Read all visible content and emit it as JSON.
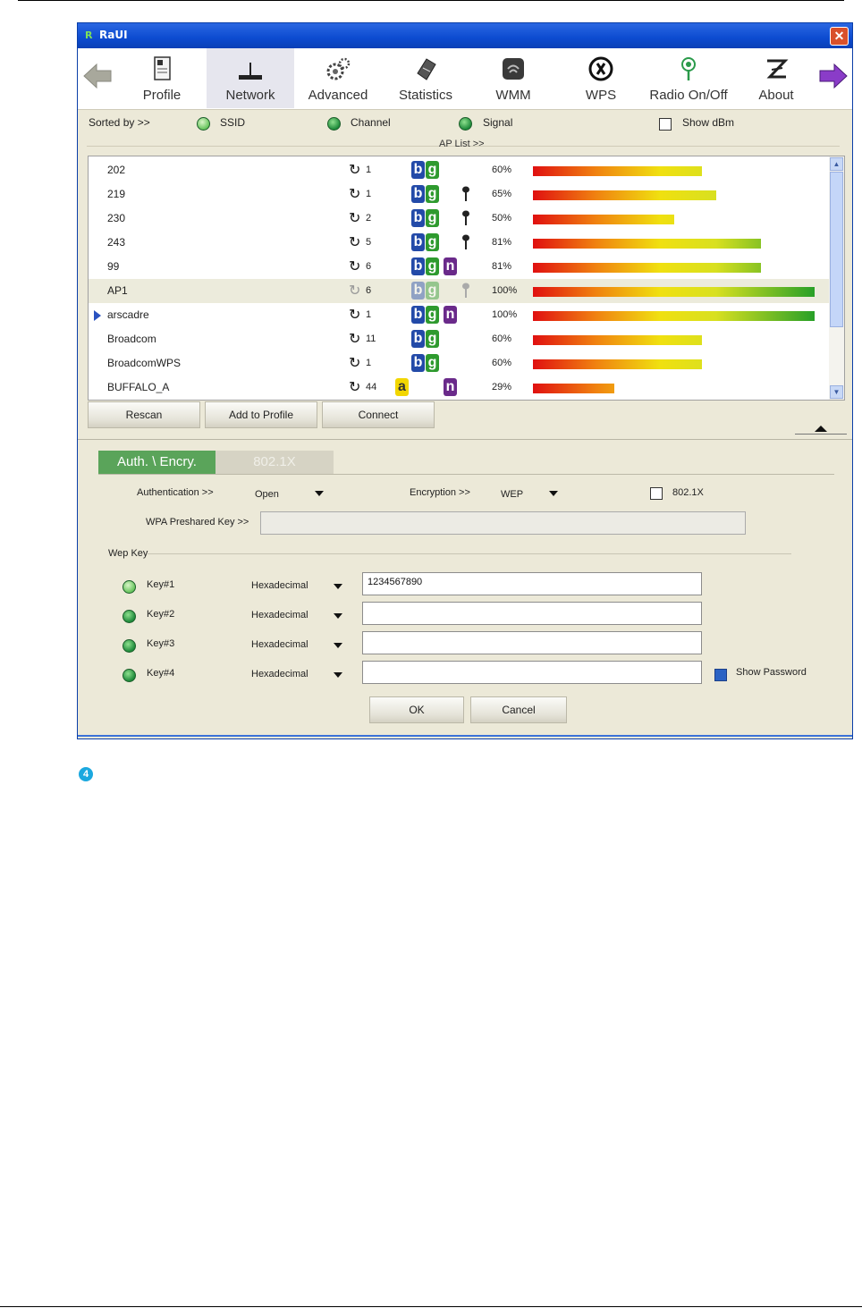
{
  "window": {
    "title": "RaUI",
    "close_glyph": "✕",
    "app_icon": "R"
  },
  "toolbar": {
    "back_icon": "arrow-left-icon",
    "forward_icon": "arrow-right-icon",
    "items": [
      {
        "label": "Profile",
        "icon": "profile-icon",
        "active": false
      },
      {
        "label": "Network",
        "icon": "network-icon",
        "active": true
      },
      {
        "label": "Advanced",
        "icon": "advanced-gear-icon",
        "active": false
      },
      {
        "label": "Statistics",
        "icon": "statistics-icon",
        "active": false
      },
      {
        "label": "WMM",
        "icon": "wmm-icon",
        "active": false
      },
      {
        "label": "WPS",
        "icon": "wps-icon",
        "active": false
      },
      {
        "label": "Radio On/Off",
        "icon": "radio-icon",
        "active": false
      },
      {
        "label": "About",
        "icon": "about-icon",
        "active": false
      }
    ]
  },
  "sort": {
    "label": "Sorted by >>",
    "ssid": "SSID",
    "channel": "Channel",
    "signal": "Signal",
    "show_dbm": "Show dBm"
  },
  "ap_list": {
    "title": "AP List >>",
    "rows": [
      {
        "ssid": "202",
        "channel": "1",
        "a": false,
        "b": true,
        "g": true,
        "n": false,
        "locked": false,
        "signal": "60%",
        "signal_value": 60,
        "selected": false,
        "connected": false
      },
      {
        "ssid": "219",
        "channel": "1",
        "a": false,
        "b": true,
        "g": true,
        "n": false,
        "locked": true,
        "signal": "65%",
        "signal_value": 65,
        "selected": false,
        "connected": false
      },
      {
        "ssid": "230",
        "channel": "2",
        "a": false,
        "b": true,
        "g": true,
        "n": false,
        "locked": true,
        "signal": "50%",
        "signal_value": 50,
        "selected": false,
        "connected": false
      },
      {
        "ssid": "243",
        "channel": "5",
        "a": false,
        "b": true,
        "g": true,
        "n": false,
        "locked": true,
        "signal": "81%",
        "signal_value": 81,
        "selected": false,
        "connected": false
      },
      {
        "ssid": "99",
        "channel": "6",
        "a": false,
        "b": true,
        "g": true,
        "n": true,
        "locked": false,
        "signal": "81%",
        "signal_value": 81,
        "selected": false,
        "connected": false
      },
      {
        "ssid": "AP1",
        "channel": "6",
        "a": false,
        "b": true,
        "g": true,
        "n": false,
        "locked": true,
        "signal": "100%",
        "signal_value": 100,
        "selected": true,
        "connected": false
      },
      {
        "ssid": "arscadre",
        "channel": "1",
        "a": false,
        "b": true,
        "g": true,
        "n": true,
        "locked": false,
        "signal": "100%",
        "signal_value": 100,
        "selected": false,
        "connected": true
      },
      {
        "ssid": "Broadcom",
        "channel": "11",
        "a": false,
        "b": true,
        "g": true,
        "n": false,
        "locked": false,
        "signal": "60%",
        "signal_value": 60,
        "selected": false,
        "connected": false
      },
      {
        "ssid": "BroadcomWPS",
        "channel": "1",
        "a": false,
        "b": true,
        "g": true,
        "n": false,
        "locked": false,
        "signal": "60%",
        "signal_value": 60,
        "selected": false,
        "connected": false
      },
      {
        "ssid": "BUFFALO_A",
        "channel": "44",
        "a": true,
        "b": false,
        "g": false,
        "n": true,
        "locked": false,
        "signal": "29%",
        "signal_value": 29,
        "selected": false,
        "connected": false
      }
    ]
  },
  "buttons": {
    "rescan": "Rescan",
    "add_to_profile": "Add to Profile",
    "connect": "Connect",
    "ok": "OK",
    "cancel": "Cancel"
  },
  "tabs": {
    "auth": "Auth. \\ Encry.",
    "dot1x": "802.1X"
  },
  "auth": {
    "authentication_label": "Authentication >>",
    "authentication_value": "Open",
    "encryption_label": "Encryption >>",
    "encryption_value": "WEP",
    "dot1x_label": "802.1X",
    "wpa_label": "WPA Preshared Key >>",
    "wpa_value": ""
  },
  "wep": {
    "title": "Wep Key",
    "keys": [
      {
        "label": "Key#1",
        "format": "Hexadecimal",
        "value": "1234567890",
        "selected": true
      },
      {
        "label": "Key#2",
        "format": "Hexadecimal",
        "value": "",
        "selected": false
      },
      {
        "label": "Key#3",
        "format": "Hexadecimal",
        "value": "",
        "selected": false
      },
      {
        "label": "Key#4",
        "format": "Hexadecimal",
        "value": "",
        "selected": false
      }
    ],
    "show_password": "Show Password"
  },
  "step": {
    "number": "4",
    "color": "#1ba8df"
  },
  "colors": {
    "title_bar": "#0c4bd0",
    "window_bg": "#ece9d8",
    "active_tab": "#5aa45a"
  }
}
